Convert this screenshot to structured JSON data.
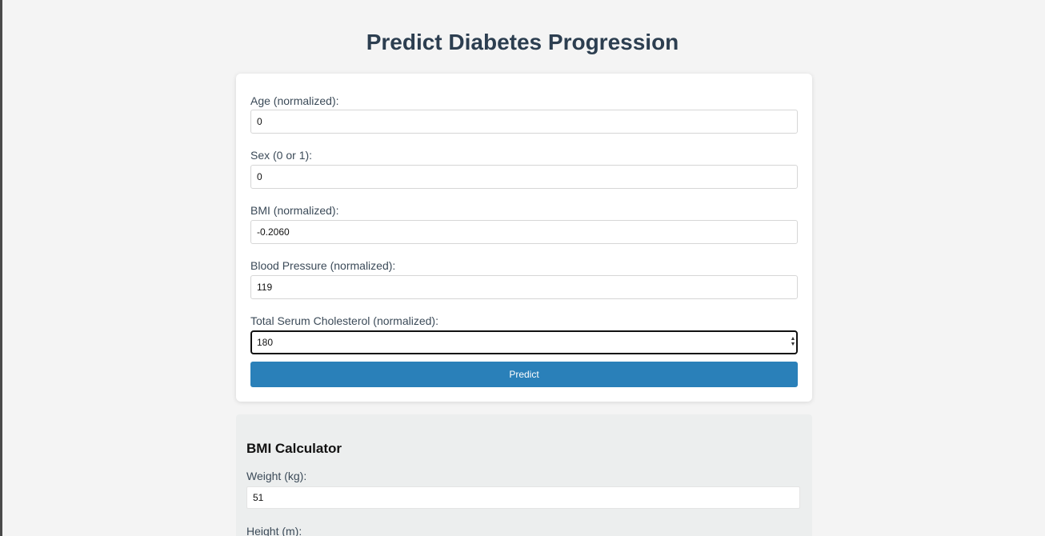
{
  "page": {
    "title": "Predict Diabetes Progression"
  },
  "form": {
    "fields": [
      {
        "label": "Age (normalized):",
        "value": "0"
      },
      {
        "label": "Sex (0 or 1):",
        "value": "0"
      },
      {
        "label": "BMI (normalized):",
        "value": "-0.2060"
      },
      {
        "label": "Blood Pressure (normalized):",
        "value": "119"
      },
      {
        "label": "Total Serum Cholesterol (normalized):",
        "value": "180"
      }
    ],
    "predict_label": "Predict"
  },
  "bmi_calculator": {
    "title": "BMI Calculator",
    "weight_label": "Weight (kg):",
    "weight_value": "51",
    "height_label": "Height (m):"
  },
  "colors": {
    "accent": "#2a80b9",
    "heading": "#2c3e50",
    "background": "#f4f4f4"
  }
}
